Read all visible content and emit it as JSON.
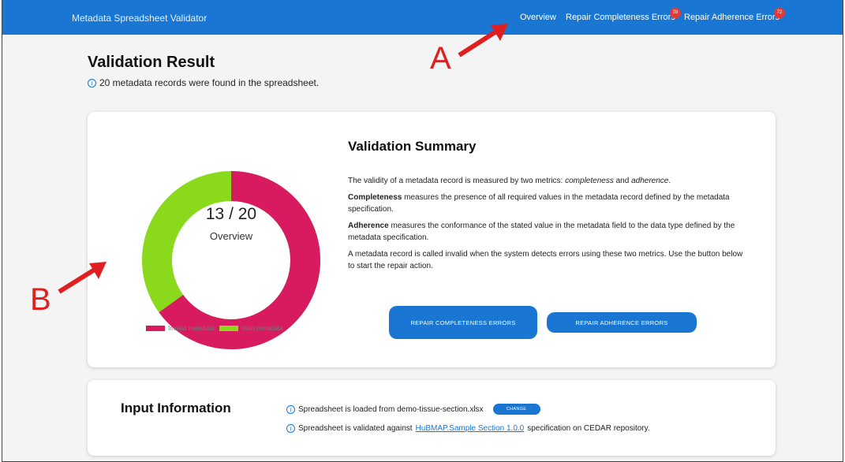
{
  "header": {
    "app_title": "Metadata Spreadsheet Validator",
    "nav": {
      "overview": "Overview",
      "repair_completeness": "Repair Completeness Errors",
      "repair_completeness_badge": "28",
      "repair_adherence": "Repair Adherence Errors",
      "repair_adherence_badge": "72"
    }
  },
  "annotations": {
    "a": "A",
    "b": "B"
  },
  "page": {
    "title": "Validation Result",
    "records_message": "20 metadata records were found in the spreadsheet."
  },
  "summary": {
    "donut": {
      "count_text": "13 / 20",
      "label": "Overview",
      "invalid_fraction": 0.65,
      "invalid_color": "#d81b60",
      "valid_color": "#8bd91c"
    },
    "legend": {
      "invalid": "Invalid metadata",
      "valid": "Valid metadata"
    },
    "title": "Validation Summary",
    "para1_pre": "The validity of a metadata record is measured by two metrics: ",
    "para1_em1": "completeness",
    "para1_mid": " and ",
    "para1_em2": "adherence",
    "para1_end": ".",
    "para2_strong": "Completeness",
    "para2_rest": " measures the presence of all required values in the metadata record defined by the metadata specification.",
    "para3_strong": "Adherence",
    "para3_rest": " measures the conformance of the stated value in the metadata field to the data type defined by the metadata specification.",
    "para4": "A metadata record is called invalid when the system detects errors using these two metrics. Use the button below to start the repair action.",
    "btn_completeness": "REPAIR COMPLETENESS ERRORS",
    "btn_adherence": "REPAIR ADHERENCE ERRORS"
  },
  "input": {
    "title": "Input Information",
    "line1": "Spreadsheet is loaded from demo-tissue-section.xlsx",
    "change_btn": "CHANGE",
    "line2_pre": "Spreadsheet is validated against ",
    "line2_link": "HuBMAP.Sample Section 1.0.0",
    "line2_post": " specification on CEDAR repository."
  },
  "colors": {
    "primary": "#1976d2",
    "badge": "#e53935",
    "annotation": "#e02020"
  }
}
